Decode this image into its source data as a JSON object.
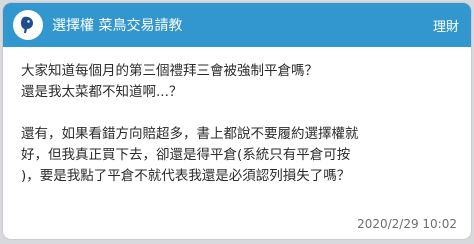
{
  "header": {
    "avatar_icon": "bird-avatar-icon",
    "title": "選擇權 菜鳥交易請教",
    "board": "理財",
    "bg_color": "#3397cf"
  },
  "post": {
    "line1": "大家知道每個月的第三個禮拜三會被強制平倉嗎？",
    "line2": "還是我太菜都不知道啊...？",
    "line3": "還有，如果看錯方向賠超多，書上都說不要履約選擇權就",
    "line4": "好，但我真正買下去，卻還是得平倉(系統只有平倉可按",
    "line5": ")，要是我點了平倉不就代表我還是必須認列損失了嗎？"
  },
  "timestamp": "2020/2/29 10:02"
}
